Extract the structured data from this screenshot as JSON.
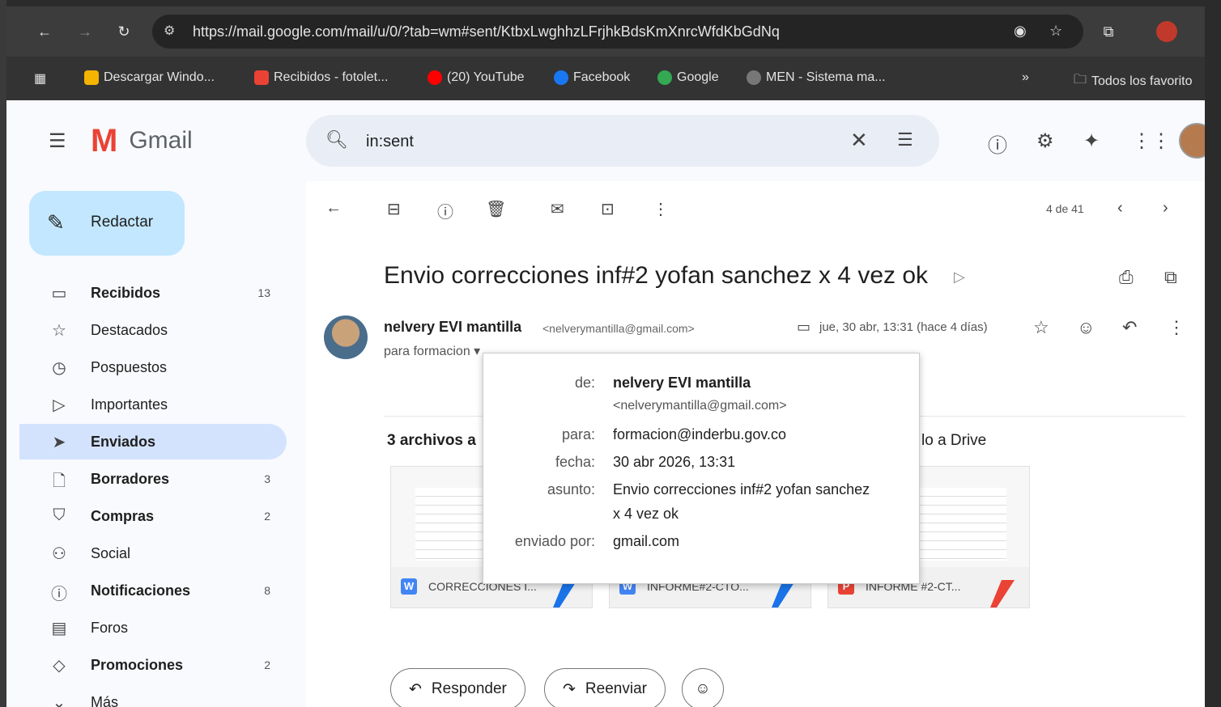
{
  "browser": {
    "url": "https://mail.google.com/mail/u/0/?tab=wm#sent/KtbxLwghhzLFrjhkBdsKmXnrcWfdKbGdNq",
    "bookmarks": [
      {
        "label": "Descargar Windo...",
        "color": "#f4b400"
      },
      {
        "label": "Recibidos - fotolet...",
        "color": "#ea4335"
      },
      {
        "label": "(20) YouTube",
        "color": "#ff0000"
      },
      {
        "label": "Facebook",
        "color": "#1877f2"
      },
      {
        "label": "Google",
        "color": "#34a853"
      },
      {
        "label": "MEN - Sistema ma...",
        "color": "#777777"
      }
    ],
    "bookmarks_more": "»",
    "all_favorites": "Todos los favorito"
  },
  "gmail": {
    "logo_text": "Gmail",
    "search_query": "in:sent",
    "compose_label": "Redactar",
    "nav": [
      {
        "label": "Recibidos",
        "count": "13",
        "icon": "inbox-icon",
        "bold": true
      },
      {
        "label": "Destacados",
        "count": "",
        "icon": "star-icon",
        "bold": false
      },
      {
        "label": "Pospuestos",
        "count": "",
        "icon": "clock-icon",
        "bold": false
      },
      {
        "label": "Importantes",
        "count": "",
        "icon": "important-icon",
        "bold": false
      },
      {
        "label": "Enviados",
        "count": "",
        "icon": "send-icon",
        "bold": true,
        "active": true
      },
      {
        "label": "Borradores",
        "count": "3",
        "icon": "draft-icon",
        "bold": true
      },
      {
        "label": "Compras",
        "count": "2",
        "icon": "shopping-icon",
        "bold": true
      },
      {
        "label": "Social",
        "count": "",
        "icon": "social-icon",
        "bold": false
      },
      {
        "label": "Notificaciones",
        "count": "8",
        "icon": "info-icon",
        "bold": true
      },
      {
        "label": "Foros",
        "count": "",
        "icon": "forum-icon",
        "bold": false
      },
      {
        "label": "Promociones",
        "count": "2",
        "icon": "tag-icon",
        "bold": true
      },
      {
        "label": "Más",
        "count": "",
        "icon": "chevron-down-icon",
        "bold": false
      }
    ]
  },
  "message": {
    "pager": "4 de 41",
    "subject": "Envio correcciones inf#2 yofan sanchez x 4 vez ok",
    "sender_name": "nelvery EVI mantilla",
    "sender_email": "<nelverymantilla@gmail.com>",
    "to_line": "para formacion",
    "date": "jue, 30 abr, 13:31 (hace 4 días)",
    "attachments_heading": "3 archivos a",
    "drive_text": "lo a Drive",
    "attachments": [
      {
        "name": "CORRECCIONES I...",
        "type": "W",
        "color": "#4285f4",
        "corner": "#1a73e8"
      },
      {
        "name": "INFORME#2-CTO...",
        "type": "W",
        "color": "#4285f4",
        "corner": "#1a73e8"
      },
      {
        "name": "INFORME #2-CT...",
        "type": "P",
        "color": "#ea4335",
        "corner": "#ea4335"
      }
    ],
    "reply_label": "Responder",
    "forward_label": "Reenviar"
  },
  "popup": {
    "rows": [
      {
        "label": "de:",
        "value": "nelvery EVI mantilla",
        "value2": "<nelverymantilla@gmail.com>"
      },
      {
        "label": "para:",
        "value": "formacion@inderbu.gov.co"
      },
      {
        "label": "fecha:",
        "value": "30 abr 2026, 13:31"
      },
      {
        "label": "asunto:",
        "value": "Envio correcciones inf#2 yofan sanchez",
        "value2": "x 4 vez ok"
      },
      {
        "label": "enviado por:",
        "value": "gmail.com"
      }
    ]
  }
}
